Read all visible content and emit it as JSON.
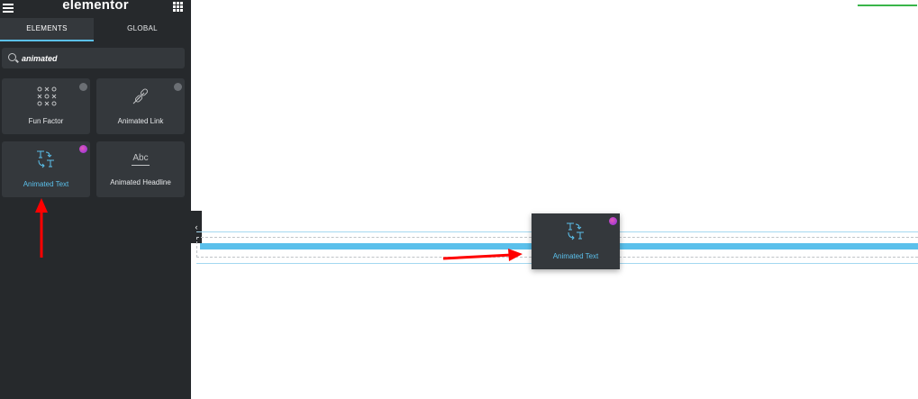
{
  "app": {
    "logo": "elementor"
  },
  "tabs": [
    {
      "label": "ELEMENTS"
    },
    {
      "label": "GLOBAL"
    }
  ],
  "search": {
    "value": "animated",
    "icon": "search-icon"
  },
  "widgets": [
    {
      "label": "Fun Factor",
      "icon": "fun-factor-icon",
      "badge": "gray"
    },
    {
      "label": "Animated Link",
      "icon": "animated-link-icon",
      "badge": "gray"
    },
    {
      "label": "Animated Text",
      "icon": "animated-text-icon",
      "badge": "pro"
    },
    {
      "label": "Animated Headline",
      "icon": "animated-headline-icon",
      "badge": "none",
      "icon_text": "Abc"
    }
  ],
  "drag_preview": {
    "label": "Animated Text"
  },
  "colors": {
    "sidebar_bg": "#26292c",
    "card_bg": "#34383c",
    "accent": "#5bc0eb",
    "arrow": "#ff0000",
    "green_bar": "#39b54a"
  }
}
